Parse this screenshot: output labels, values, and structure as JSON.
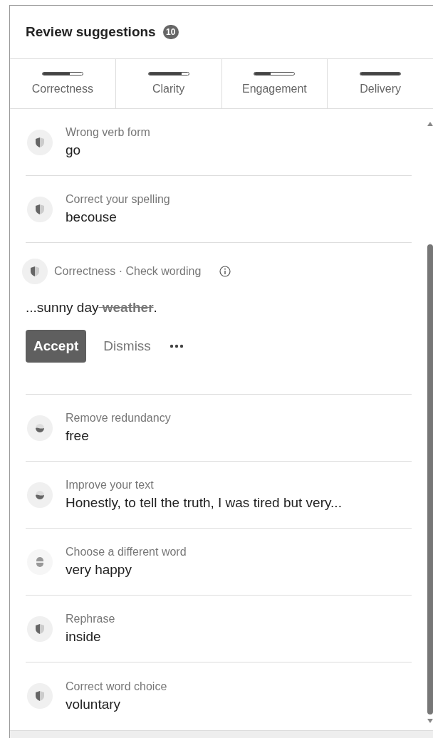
{
  "header": {
    "title": "Review suggestions",
    "count": "10"
  },
  "tabs": [
    {
      "label": "Correctness",
      "level": 0.68
    },
    {
      "label": "Clarity",
      "level": 0.83
    },
    {
      "label": "Engagement",
      "level": 0.4
    },
    {
      "label": "Delivery",
      "level": 1
    }
  ],
  "suggestions": [
    {
      "kind": "shield",
      "title": "Wrong verb form",
      "text": "go"
    },
    {
      "kind": "shield",
      "title": "Correct your spelling",
      "text": "becouse"
    },
    {
      "kind": "expanded",
      "category": "Correctness · Check wording",
      "kept": "...sunny day",
      "removed": " weather",
      "ending": ".",
      "accept": "Accept",
      "dismiss": "Dismiss"
    },
    {
      "kind": "crescent",
      "title": "Remove redundancy",
      "text": "free"
    },
    {
      "kind": "crescent",
      "title": "Improve your text",
      "text": "Honestly, to tell the truth, I was tired but very..."
    },
    {
      "kind": "pill",
      "title": "Choose a different word",
      "text": "very happy"
    },
    {
      "kind": "shield",
      "title": "Rephrase",
      "text": "inside"
    },
    {
      "kind": "shield",
      "title": "Correct word choice",
      "text": "voluntary"
    }
  ]
}
